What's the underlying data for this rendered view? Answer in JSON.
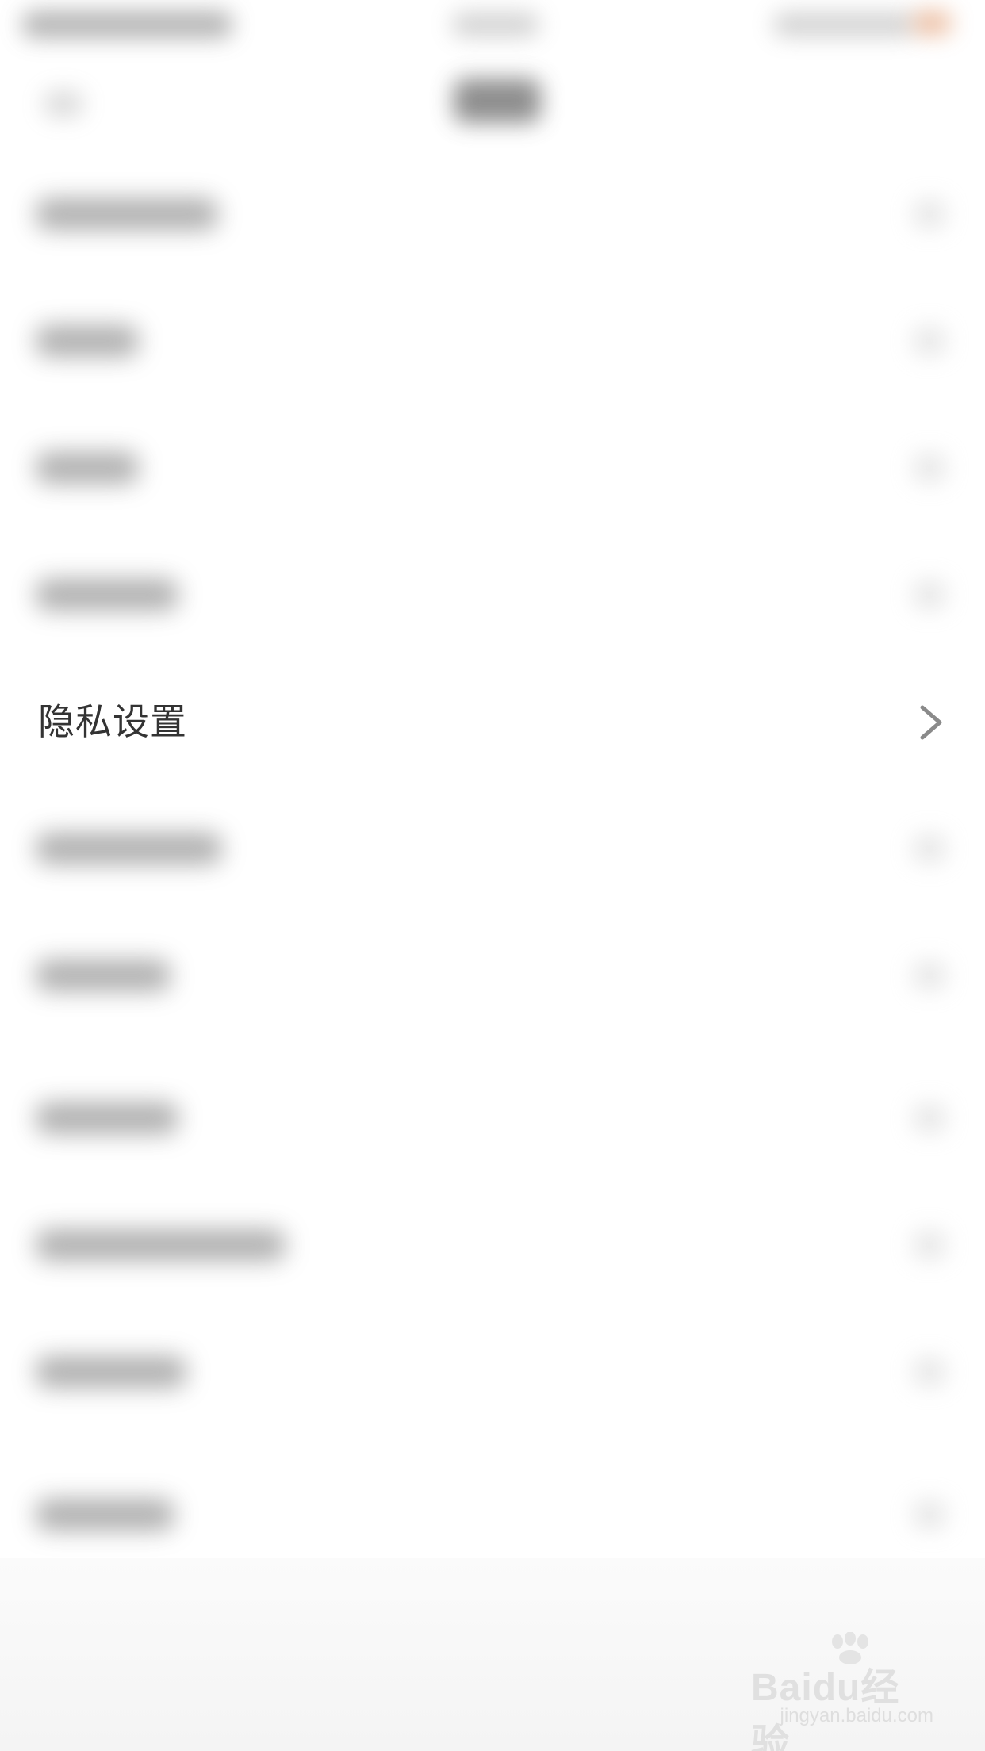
{
  "list": {
    "privacy_label": "隐私设置"
  },
  "watermark": {
    "brand": "Baidu经验",
    "url": "jingyan.baidu.com"
  },
  "icons": {
    "row_chevron": "chevron-right-icon"
  }
}
